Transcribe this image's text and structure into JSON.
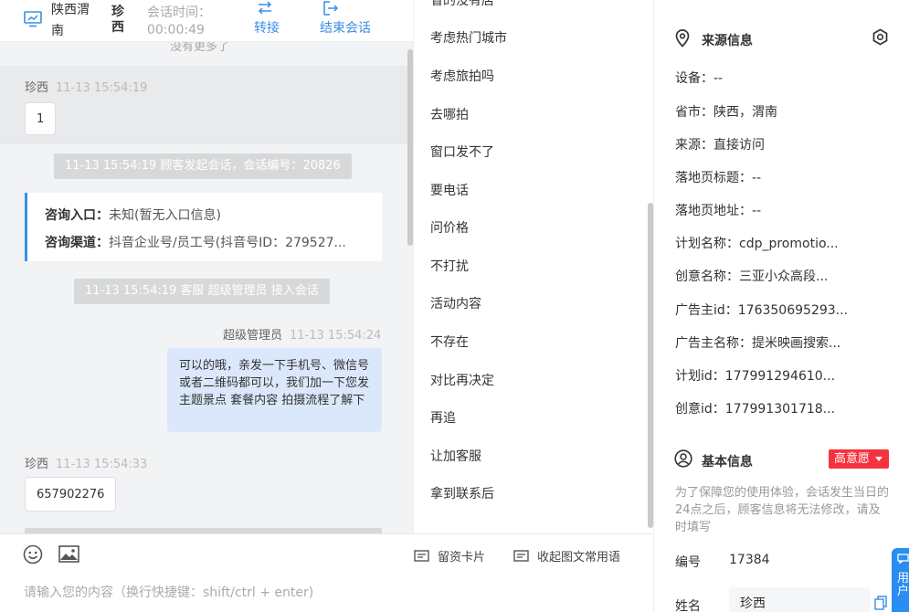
{
  "header": {
    "location": "陕西渭南",
    "customer": "珍西",
    "time_label": "会话时间：",
    "time_value": "00:00:49",
    "transfer_label": "转接",
    "end_label": "结束会话"
  },
  "chat": {
    "no_more": "没有更多了",
    "messages": [
      {
        "sender": "珍西",
        "time": "11-13 15:54:19",
        "text": "1"
      },
      {
        "system": "11-13 15:54:19 顾客发起会话，会话编号：20826"
      },
      {
        "consult": [
          {
            "key": "咨询入口：",
            "value": "未知(暂无入口信息)"
          },
          {
            "key": "咨询渠道：",
            "value": "抖音企业号/员工号(抖音号ID：279527..."
          }
        ]
      },
      {
        "system": "11-13 15:54:19 客服 超级管理员 接入会话"
      },
      {
        "sender": "超级管理员",
        "time": "11-13 15:54:24",
        "text": "可以的哦，亲发一下手机号、微信号或者二维码都可以，我们加一下您发主题景点 套餐内容 拍摄流程了解下"
      },
      {
        "sender": "珍西",
        "time": "11-13 15:54:33",
        "text": "657902276"
      }
    ]
  },
  "input": {
    "card_label": "留资卡片",
    "quick_label": "收起图文常用语",
    "placeholder": "请输入您的内容（换行快捷键：shift/ctrl + enter)"
  },
  "quick_replies": [
    "省的没有店",
    "考虑热门城市",
    "考虑旅拍吗",
    "去哪拍",
    "窗口发不了",
    "要电话",
    "问价格",
    "不打扰",
    "活动内容",
    "不存在",
    "对比再决定",
    "再追",
    "让加客服",
    "拿到联系后"
  ],
  "source_info": {
    "title": "来源信息",
    "rows": [
      "设备：--",
      "省市：陕西，渭南",
      "来源：直接访问",
      "落地页标题：--",
      "落地页地址：--",
      "计划名称：cdp_promotio...",
      "创意名称：三亚小众高段...",
      "广告主id：176350695293...",
      "广告主名称：提米映画搜索...",
      "计划id：177991294610...",
      "创意id：177991301718..."
    ]
  },
  "basic_info": {
    "title": "基本信息",
    "tag": "高意愿",
    "notice": "为了保障您的使用体验，会话发生当日的24点之后，顾客信息将无法修改，请及时填写",
    "id_label": "编号",
    "id_value": "17384",
    "name_label": "姓名",
    "name_value": "珍西"
  },
  "float_button": {
    "label": "用户"
  },
  "colors": {
    "accent": "#3a8ee6",
    "tag_red": "#f5333f",
    "agent_bubble": "#dbe8fb",
    "chat_bg": "#f2f3f5"
  }
}
